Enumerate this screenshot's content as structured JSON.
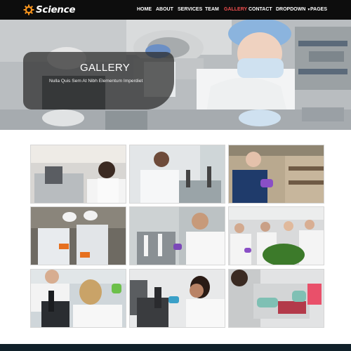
{
  "brand": {
    "name": "Science",
    "logo_icon": "gear-icon"
  },
  "nav": {
    "items": [
      {
        "label": "HOME",
        "active": false
      },
      {
        "label": "ABOUT",
        "active": false
      },
      {
        "label": "SERVICES",
        "active": false
      },
      {
        "label": "TEAM",
        "active": false
      },
      {
        "label": "GALLERY",
        "active": true
      },
      {
        "label": "CONTACT",
        "active": false
      },
      {
        "label": "DROPDOWN",
        "active": false,
        "has_caret": true
      },
      {
        "label": "PAGES",
        "active": false
      }
    ],
    "active_color": "#f04e4e"
  },
  "hero": {
    "title": "GALLERY",
    "subtitle": "Nulla Quis Sem At Nibh Elementum Imperdiet"
  },
  "gallery": {
    "images": [
      {
        "subject": "scientist-at-lab-bench"
      },
      {
        "subject": "scientist-writing-with-microscope"
      },
      {
        "subject": "scientist-purple-gloves-shelves"
      },
      {
        "subject": "two-workers-hard-hats"
      },
      {
        "subject": "scientist-glasses-purple-gloves"
      },
      {
        "subject": "team-of-scientists-with-plants"
      },
      {
        "subject": "two-scientists-with-microscopes"
      },
      {
        "subject": "scientist-using-microscope"
      },
      {
        "subject": "hands-pipetting-samples"
      }
    ]
  },
  "colors": {
    "navbar": "#0d0d0d",
    "accent": "#f04e4e",
    "logo_orange": "#f7941d",
    "footer": "#10202a"
  }
}
